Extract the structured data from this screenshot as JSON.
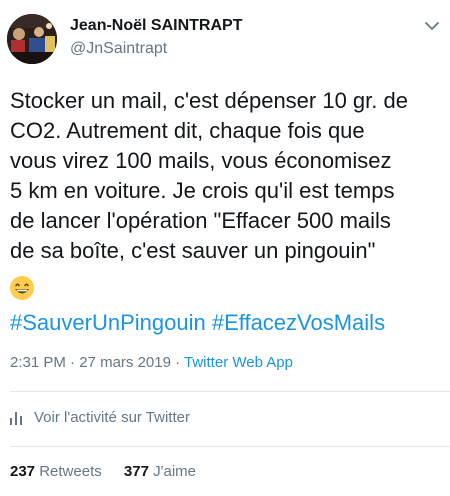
{
  "author": {
    "display_name": "Jean-Noël SAINTRAPT",
    "handle": "@JnSaintrapt",
    "avatar_icon": "avatar-photo"
  },
  "tweet": {
    "lines": [
      "Stocker un mail, c'est dépenser 10 gr. de",
      "CO2. Autrement dit, chaque fois que",
      "vous virez 100 mails, vous économisez",
      "5 km en voiture. Je crois qu'il est temps",
      "de lancer l'opération \"Effacer 500 mails",
      "de sa boîte, c'est sauver un pingouin\""
    ],
    "emoji": "grinning-face-with-smiling-eyes",
    "hashtags": [
      "#SauverUnPingouin",
      "#EffacezVosMails"
    ]
  },
  "meta": {
    "time": "2:31 PM",
    "separator1": " · ",
    "date": "27 mars 2019",
    "separator2": " · ",
    "app": "Twitter Web App"
  },
  "activity": {
    "label": "Voir l'activité sur Twitter",
    "icon": "stats-bar-icon"
  },
  "stats": {
    "retweets_count": "237",
    "retweets_label": "Retweets",
    "likes_count": "377",
    "likes_label": "J'aime"
  },
  "colors": {
    "link": "#1b95e0",
    "secondary_text": "#657786",
    "divider": "#e1e8ed"
  }
}
